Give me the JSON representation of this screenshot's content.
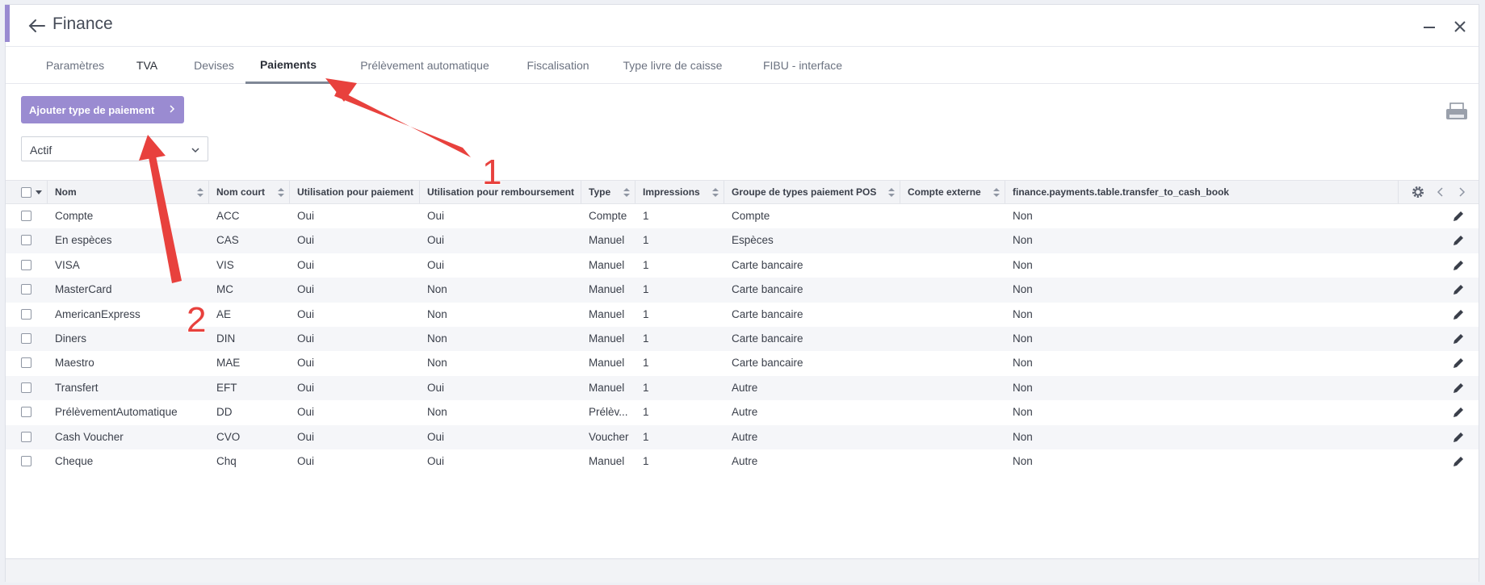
{
  "header": {
    "title": "Finance"
  },
  "tabs": [
    {
      "label": "Paramètres"
    },
    {
      "label": "TVA"
    },
    {
      "label": "Devises"
    },
    {
      "label": "Paiements"
    },
    {
      "label": "Prélèvement automatique"
    },
    {
      "label": "Fiscalisation"
    },
    {
      "label": "Type livre de caisse"
    },
    {
      "label": "FIBU - interface"
    }
  ],
  "toolbar": {
    "add_label": "Ajouter type de paiement"
  },
  "filter": {
    "value": "Actif"
  },
  "table": {
    "columns": [
      "Nom",
      "Nom court",
      "Utilisation pour paiement",
      "Utilisation pour remboursement",
      "Type",
      "Impressions",
      "Groupe de types paiement POS",
      "Compte externe",
      "finance.payments.table.transfer_to_cash_book"
    ],
    "rows": [
      [
        "Compte",
        "ACC",
        "Oui",
        "Oui",
        "Compte",
        "1",
        "Compte",
        "",
        "Non"
      ],
      [
        "En espèces",
        "CAS",
        "Oui",
        "Oui",
        "Manuel",
        "1",
        "Espèces",
        "",
        "Non"
      ],
      [
        "VISA",
        "VIS",
        "Oui",
        "Oui",
        "Manuel",
        "1",
        "Carte bancaire",
        "",
        "Non"
      ],
      [
        "MasterCard",
        "MC",
        "Oui",
        "Non",
        "Manuel",
        "1",
        "Carte bancaire",
        "",
        "Non"
      ],
      [
        "AmericanExpress",
        "AE",
        "Oui",
        "Non",
        "Manuel",
        "1",
        "Carte bancaire",
        "",
        "Non"
      ],
      [
        "Diners",
        "DIN",
        "Oui",
        "Non",
        "Manuel",
        "1",
        "Carte bancaire",
        "",
        "Non"
      ],
      [
        "Maestro",
        "MAE",
        "Oui",
        "Non",
        "Manuel",
        "1",
        "Carte bancaire",
        "",
        "Non"
      ],
      [
        "Transfert",
        "EFT",
        "Oui",
        "Oui",
        "Manuel",
        "1",
        "Autre",
        "",
        "Non"
      ],
      [
        "PrélèvementAutomatique",
        "DD",
        "Oui",
        "Non",
        "Prélèv...",
        "1",
        "Autre",
        "",
        "Non"
      ],
      [
        "Cash Voucher",
        "CVO",
        "Oui",
        "Oui",
        "Voucher",
        "1",
        "Autre",
        "",
        "Non"
      ],
      [
        "Cheque",
        "Chq",
        "Oui",
        "Oui",
        "Manuel",
        "1",
        "Autre",
        "",
        "Non"
      ]
    ]
  },
  "annotations": {
    "label_1": "1",
    "label_2": "2"
  },
  "colors": {
    "accent": "#9a8bd1",
    "arrow": "#e8413d"
  }
}
